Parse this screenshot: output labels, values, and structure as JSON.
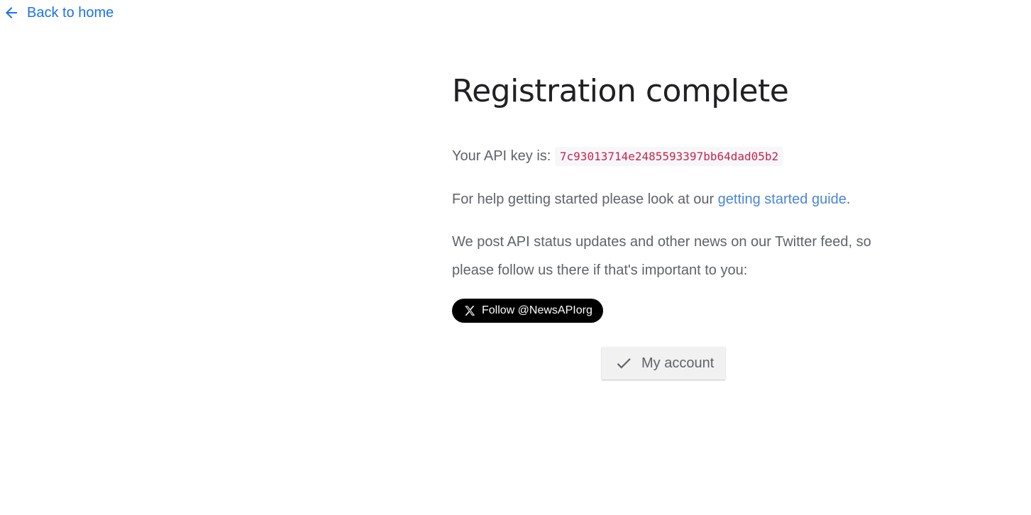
{
  "nav": {
    "back_label": "Back to home",
    "back_icon": "arrow-left-icon"
  },
  "main": {
    "title": "Registration complete",
    "api_key_prefix": "Your API key is:",
    "api_key": "7c93013714e2485593397bb64dad05b2",
    "help_prefix": "For help getting started please look at our ",
    "help_link": "getting started guide",
    "help_suffix": ".",
    "twitter_text": "We post API status updates and other news on our Twitter feed, so please follow us there if that's important to you:",
    "follow_label": "Follow @NewsAPIorg",
    "follow_icon": "x-logo-icon",
    "account_label": "My account",
    "account_icon": "check-icon"
  },
  "colors": {
    "link": "#1a73e8",
    "api_key_text": "#c7254e",
    "follow_bg": "#000000"
  }
}
